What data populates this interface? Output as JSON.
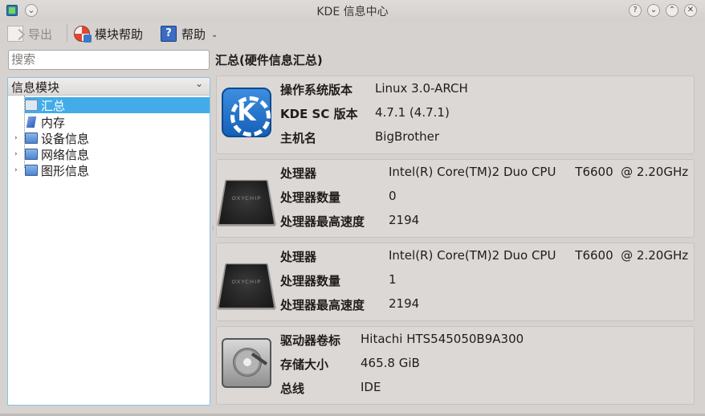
{
  "window": {
    "title": "KDE 信息中心",
    "buttons": [
      "?",
      "⌄",
      "⌃",
      "✕"
    ]
  },
  "toolbar": {
    "export_label": "导出",
    "module_help_label": "模块帮助",
    "help_label": "帮助",
    "more_icon": "⌄"
  },
  "search": {
    "placeholder": "搜索"
  },
  "section_title": "汇总(硬件信息汇总)",
  "sidebar": {
    "header": "信息模块",
    "items": [
      {
        "label": "汇总",
        "icon": "summary-icon",
        "selected": true,
        "expandable": false
      },
      {
        "label": "内存",
        "icon": "memory-icon",
        "selected": false,
        "expandable": false
      },
      {
        "label": "设备信息",
        "icon": "folder-icon",
        "selected": false,
        "expandable": true
      },
      {
        "label": "网络信息",
        "icon": "folder-icon",
        "selected": false,
        "expandable": true
      },
      {
        "label": "图形信息",
        "icon": "folder-icon",
        "selected": false,
        "expandable": true
      }
    ]
  },
  "panels": [
    {
      "icon": "kde-logo-icon",
      "rows": [
        {
          "key": "操作系统版本",
          "value": "Linux 3.0-ARCH"
        },
        {
          "key": "KDE SC 版本",
          "value": "4.7.1 (4.7.1)"
        },
        {
          "key": "主机名",
          "value": "BigBrother"
        }
      ]
    },
    {
      "icon": "cpu-chip-icon",
      "rows": [
        {
          "key": "处理器",
          "value": "Intel(R) Core(TM)2 Duo CPU     T6600  @ 2.20GHz"
        },
        {
          "key": "处理器数量",
          "value": "0"
        },
        {
          "key": "处理器最高速度",
          "value": "2194"
        }
      ]
    },
    {
      "icon": "cpu-chip-icon",
      "rows": [
        {
          "key": "处理器",
          "value": "Intel(R) Core(TM)2 Duo CPU     T6600  @ 2.20GHz"
        },
        {
          "key": "处理器数量",
          "value": "1"
        },
        {
          "key": "处理器最高速度",
          "value": "2194"
        }
      ]
    },
    {
      "icon": "hard-disk-icon",
      "rows": [
        {
          "key": "驱动器卷标",
          "value": "Hitachi HTS545050B9A300"
        },
        {
          "key": "存储大小",
          "value": "465.8 GiB"
        },
        {
          "key": "总线",
          "value": "IDE"
        }
      ]
    }
  ]
}
